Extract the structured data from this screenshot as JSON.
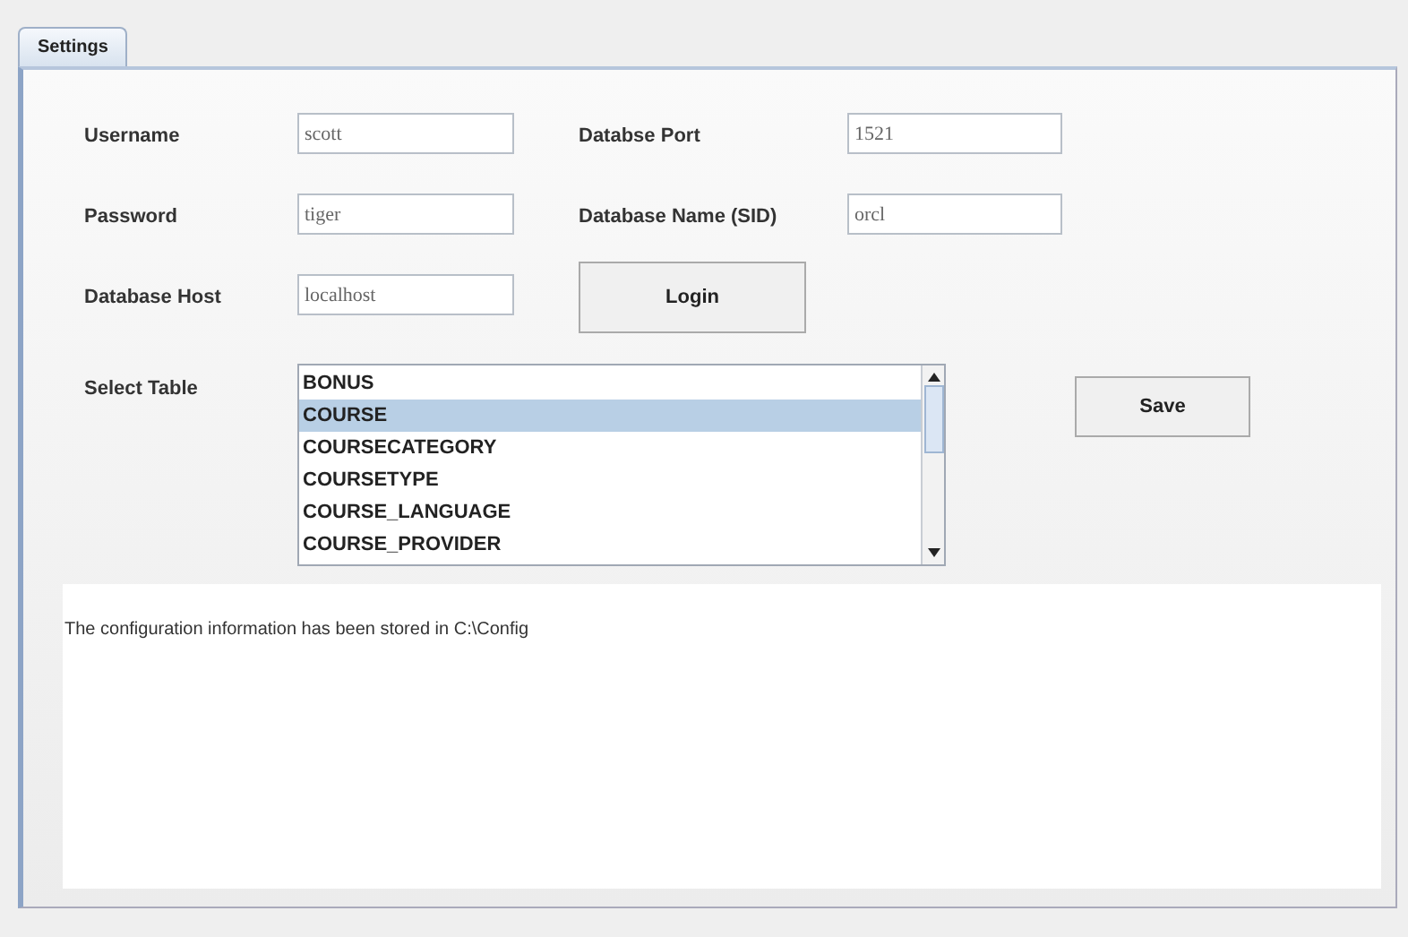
{
  "tabs": [
    {
      "label": "Settings",
      "selected": true
    }
  ],
  "fields": [
    {
      "label": "Username",
      "value": "scott"
    },
    {
      "label": "Databse Port",
      "value": "1521"
    },
    {
      "label": "Password",
      "value": "tiger"
    },
    {
      "label": "Database Name (SID)",
      "value": "orcl"
    },
    {
      "label": "Database Host",
      "value": "localhost"
    }
  ],
  "login_button": "Login",
  "select_table": {
    "label": "Select Table",
    "items": [
      {
        "text": "BONUS",
        "selected": false
      },
      {
        "text": "COURSE",
        "selected": true
      },
      {
        "text": "COURSECATEGORY",
        "selected": false
      },
      {
        "text": "COURSETYPE",
        "selected": false
      },
      {
        "text": "COURSE_LANGUAGE",
        "selected": false
      },
      {
        "text": "COURSE_PROVIDER",
        "selected": false
      }
    ]
  },
  "save_button": "Save",
  "message": "The configuration information has been stored in C:\\Config"
}
